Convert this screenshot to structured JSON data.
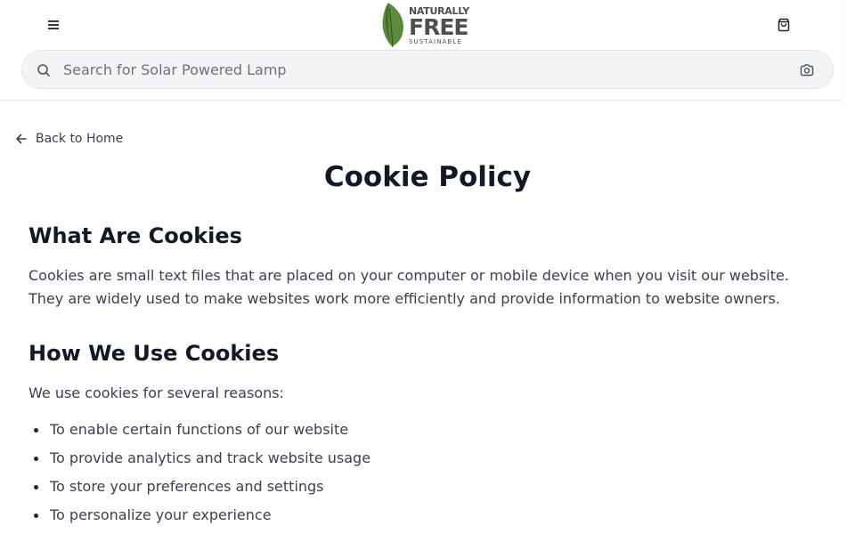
{
  "header": {
    "logo": {
      "line1": "NATURALLY",
      "line2": "FREE",
      "line3": "SUSTAINABLE"
    },
    "menu_icon": "hamburger-menu-icon",
    "cart_icon": "shopping-bag-icon"
  },
  "search": {
    "placeholder": "Search for Solar Powered Lamp",
    "value": "",
    "icon": "search-icon",
    "camera_icon": "camera-icon"
  },
  "nav": {
    "back_label": "Back to Home",
    "back_icon": "arrow-left-icon"
  },
  "page": {
    "title": "Cookie Policy",
    "sections": [
      {
        "heading": "What Are Cookies",
        "paragraph_line1": "Cookies are small text files that are placed on your computer or mobile device when you visit our website.",
        "paragraph_line2": "They are widely used to make websites work more efficiently and provide information to website owners."
      },
      {
        "heading": "How We Use Cookies",
        "intro": "We use cookies for several reasons:",
        "items": [
          "To enable certain functions of our website",
          "To provide analytics and track website usage",
          "To store your preferences and settings",
          "To personalize your experience"
        ]
      }
    ]
  },
  "colors": {
    "logo_leaf": "#5a8a3a",
    "text_primary": "#111827",
    "text_body": "#374151",
    "search_bg": "#f3f4f6"
  }
}
